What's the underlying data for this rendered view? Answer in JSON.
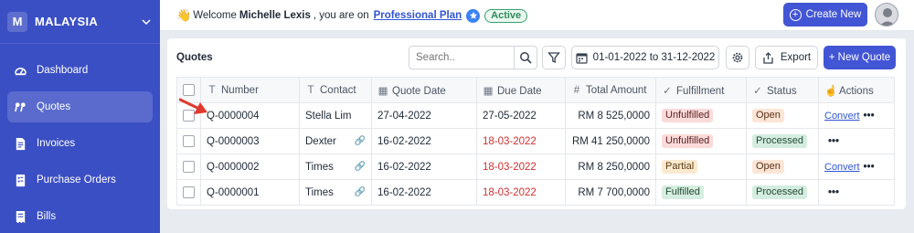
{
  "org": {
    "initial": "M",
    "name": "MALAYSIA"
  },
  "sidebar": {
    "items": [
      {
        "label": "Dashboard",
        "icon": "dashboard-icon"
      },
      {
        "label": "Quotes",
        "icon": "quote-icon",
        "active": true
      },
      {
        "label": "Invoices",
        "icon": "invoice-icon"
      },
      {
        "label": "Purchase Orders",
        "icon": "purchase-order-icon"
      },
      {
        "label": "Bills",
        "icon": "bill-icon"
      }
    ]
  },
  "topbar": {
    "welcome_prefix": "Welcome",
    "user_name": "Michelle Lexis",
    "welcome_suffix": ", you are on",
    "plan": "Professional Plan",
    "status": "Active",
    "create_label": "Create New"
  },
  "quotes": {
    "title": "Quotes",
    "search_placeholder": "Search..",
    "date_range": "01-01-2022 to 31-12-2022",
    "export_label": "Export",
    "new_label": "+ New Quote",
    "columns": [
      "Number",
      "Contact",
      "Quote Date",
      "Due Date",
      "Total Amount",
      "Fulfillment",
      "Status",
      "Actions"
    ],
    "rows": [
      {
        "number": "Q-0000004",
        "contact": "Stella Lim",
        "quote_date": "27-04-2022",
        "due_date": "27-05-2022",
        "total": "RM 8 525,0000",
        "fulfillment": "Unfulfilled",
        "status": "Open",
        "action": "Convert"
      },
      {
        "number": "Q-0000003",
        "contact": "Dexter",
        "quote_date": "16-02-2022",
        "due_date": "18-03-2022",
        "total": "RM 41 250,0000",
        "fulfillment": "Unfulfilled",
        "status": "Processed",
        "action": ""
      },
      {
        "number": "Q-0000002",
        "contact": "Times",
        "quote_date": "16-02-2022",
        "due_date": "18-03-2022",
        "total": "RM 8 250,0000",
        "fulfillment": "Partial",
        "status": "Open",
        "action": "Convert"
      },
      {
        "number": "Q-0000001",
        "contact": "Times",
        "quote_date": "16-02-2022",
        "due_date": "18-03-2022",
        "total": "RM 7 700,0000",
        "fulfillment": "Fulfilled",
        "status": "Processed",
        "action": ""
      }
    ]
  },
  "colors": {
    "sidebar": "#3b4fc4",
    "primary": "#4255d4",
    "overdue": "#d22f2f",
    "annotation_arrow": "#e03a2f"
  }
}
